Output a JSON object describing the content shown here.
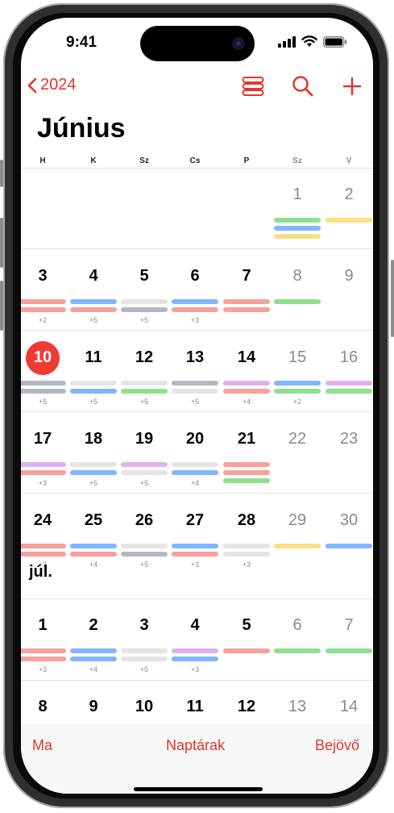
{
  "status": {
    "time": "9:41"
  },
  "nav": {
    "back_label": "2024"
  },
  "month": {
    "title": "Június",
    "next_month_label": "júl."
  },
  "weekdays": [
    "H",
    "K",
    "Sz",
    "Cs",
    "P",
    "Sz",
    "V"
  ],
  "calendar": {
    "today": "10",
    "colors": {
      "red": "#f6a19c",
      "blue": "#7fb6ff",
      "gray": "#b2b8c3",
      "lightgray": "#e4e4e4",
      "green": "#8fe08e",
      "yellow": "#fbe17f",
      "purple": "#e0b0ef"
    },
    "weeks": [
      {
        "days": [
          {
            "n": "",
            "bars": [],
            "more": ""
          },
          {
            "n": "",
            "bars": [],
            "more": ""
          },
          {
            "n": "",
            "bars": [],
            "more": ""
          },
          {
            "n": "",
            "bars": [],
            "more": ""
          },
          {
            "n": "",
            "bars": [],
            "more": ""
          },
          {
            "n": "1",
            "bars": [
              "green",
              "blue",
              "yellow"
            ],
            "more": ""
          },
          {
            "n": "2",
            "bars": [
              "yellow"
            ],
            "more": ""
          }
        ]
      },
      {
        "days": [
          {
            "n": "3",
            "bars": [
              "red",
              "red"
            ],
            "more": "+2"
          },
          {
            "n": "4",
            "bars": [
              "blue",
              "red"
            ],
            "more": "+5"
          },
          {
            "n": "5",
            "bars": [
              "lightgray",
              "gray"
            ],
            "more": "+5"
          },
          {
            "n": "6",
            "bars": [
              "blue",
              "red"
            ],
            "more": "+3"
          },
          {
            "n": "7",
            "bars": [
              "red",
              "red"
            ],
            "more": ""
          },
          {
            "n": "8",
            "bars": [
              "green"
            ],
            "more": ""
          },
          {
            "n": "9",
            "bars": [],
            "more": ""
          }
        ]
      },
      {
        "days": [
          {
            "n": "10",
            "bars": [
              "gray",
              "gray"
            ],
            "more": "+5"
          },
          {
            "n": "11",
            "bars": [
              "lightgray",
              "blue"
            ],
            "more": "+5"
          },
          {
            "n": "12",
            "bars": [
              "lightgray",
              "green"
            ],
            "more": "+5"
          },
          {
            "n": "13",
            "bars": [
              "gray",
              "lightgray"
            ],
            "more": "+5"
          },
          {
            "n": "14",
            "bars": [
              "purple",
              "red"
            ],
            "more": "+4"
          },
          {
            "n": "15",
            "bars": [
              "blue",
              "green"
            ],
            "more": "+2"
          },
          {
            "n": "16",
            "bars": [
              "purple",
              "green"
            ],
            "more": ""
          }
        ]
      },
      {
        "days": [
          {
            "n": "17",
            "bars": [
              "purple",
              "red"
            ],
            "more": "+3"
          },
          {
            "n": "18",
            "bars": [
              "lightgray",
              "blue"
            ],
            "more": "+5"
          },
          {
            "n": "19",
            "bars": [
              "purple",
              "lightgray"
            ],
            "more": "+5"
          },
          {
            "n": "20",
            "bars": [
              "lightgray",
              "blue"
            ],
            "more": "+4"
          },
          {
            "n": "21",
            "bars": [
              "red",
              "red",
              "green"
            ],
            "more": ""
          },
          {
            "n": "22",
            "bars": [],
            "more": ""
          },
          {
            "n": "23",
            "bars": [],
            "more": ""
          }
        ]
      },
      {
        "days": [
          {
            "n": "24",
            "bars": [
              "red",
              "red"
            ],
            "more": "+3"
          },
          {
            "n": "25",
            "bars": [
              "blue",
              "red"
            ],
            "more": "+4"
          },
          {
            "n": "26",
            "bars": [
              "lightgray",
              "gray"
            ],
            "more": "+5"
          },
          {
            "n": "27",
            "bars": [
              "blue",
              "red"
            ],
            "more": "+3"
          },
          {
            "n": "28",
            "bars": [
              "lightgray",
              "lightgray"
            ],
            "more": "+3"
          },
          {
            "n": "29",
            "bars": [
              "yellow"
            ],
            "more": ""
          },
          {
            "n": "30",
            "bars": [
              "blue"
            ],
            "more": ""
          }
        ]
      },
      {
        "days": [
          {
            "n": "1",
            "bars": [
              "red",
              "red"
            ],
            "more": "+3"
          },
          {
            "n": "2",
            "bars": [
              "blue",
              "blue"
            ],
            "more": "+4"
          },
          {
            "n": "3",
            "bars": [
              "lightgray",
              "lightgray"
            ],
            "more": "+5"
          },
          {
            "n": "4",
            "bars": [
              "purple",
              "blue"
            ],
            "more": "+3"
          },
          {
            "n": "5",
            "bars": [
              "red"
            ],
            "more": ""
          },
          {
            "n": "6",
            "bars": [
              "green"
            ],
            "more": ""
          },
          {
            "n": "7",
            "bars": [
              "green"
            ],
            "more": ""
          }
        ]
      },
      {
        "days": [
          {
            "n": "8",
            "bars": [
              "red"
            ],
            "more": ""
          },
          {
            "n": "9",
            "bars": [
              "blue"
            ],
            "more": ""
          },
          {
            "n": "10",
            "bars": [
              "lightgray"
            ],
            "more": ""
          },
          {
            "n": "11",
            "bars": [
              "purple"
            ],
            "more": ""
          },
          {
            "n": "12",
            "bars": [
              "red"
            ],
            "more": ""
          },
          {
            "n": "13",
            "bars": [
              "green"
            ],
            "more": ""
          },
          {
            "n": "14",
            "bars": [
              "green"
            ],
            "more": ""
          }
        ]
      }
    ]
  },
  "tabbar": {
    "today": "Ma",
    "calendars": "Naptárak",
    "inbox": "Bejövő"
  },
  "icons": {
    "back": "chevron-left-icon",
    "list": "list-view-icon",
    "search": "search-icon",
    "add": "plus-icon",
    "signal": "cellular-signal-icon",
    "wifi": "wifi-icon",
    "battery": "battery-icon"
  }
}
